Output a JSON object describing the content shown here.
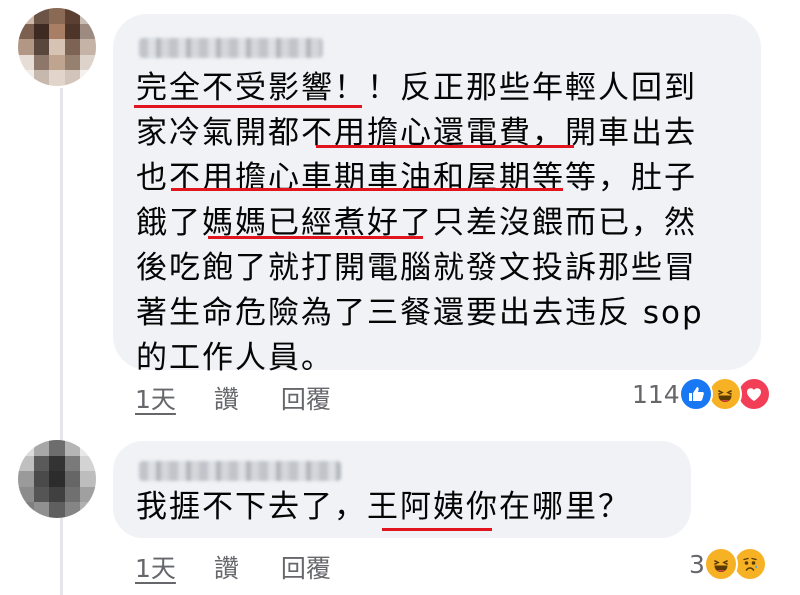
{
  "comments": [
    {
      "lines": [
        "完全不受影響！！反正那些年輕人回到",
        "家冷氣開都不用擔心還電費，開車出去",
        "也不用擔心車期車油和屋期等等，肚子",
        "餓了媽媽已經煮好了只差沒餵而已，然",
        "後吃飽了就打開電腦就發文投訴那些冒",
        "著生命危險為了三餐還要出去违反 sop",
        "的工作人員。"
      ],
      "time": "1天",
      "like_label": "讚",
      "reply_label": "回覆",
      "reaction_count": "114",
      "reactions": [
        "like-icon",
        "haha-icon",
        "love-icon"
      ]
    },
    {
      "lines": [
        "我捱不下去了，王阿姨你在哪里？"
      ],
      "time": "1天",
      "like_label": "讚",
      "reply_label": "回覆",
      "reaction_count": "3",
      "reactions": [
        "haha-icon",
        "sad-icon"
      ]
    }
  ],
  "colors": {
    "bubble": "#f0f2f5",
    "underline": "#e0151d",
    "meta_text": "#65676b",
    "like": "#1877f2",
    "love": "#f33e58",
    "haha": "#f7b125"
  }
}
